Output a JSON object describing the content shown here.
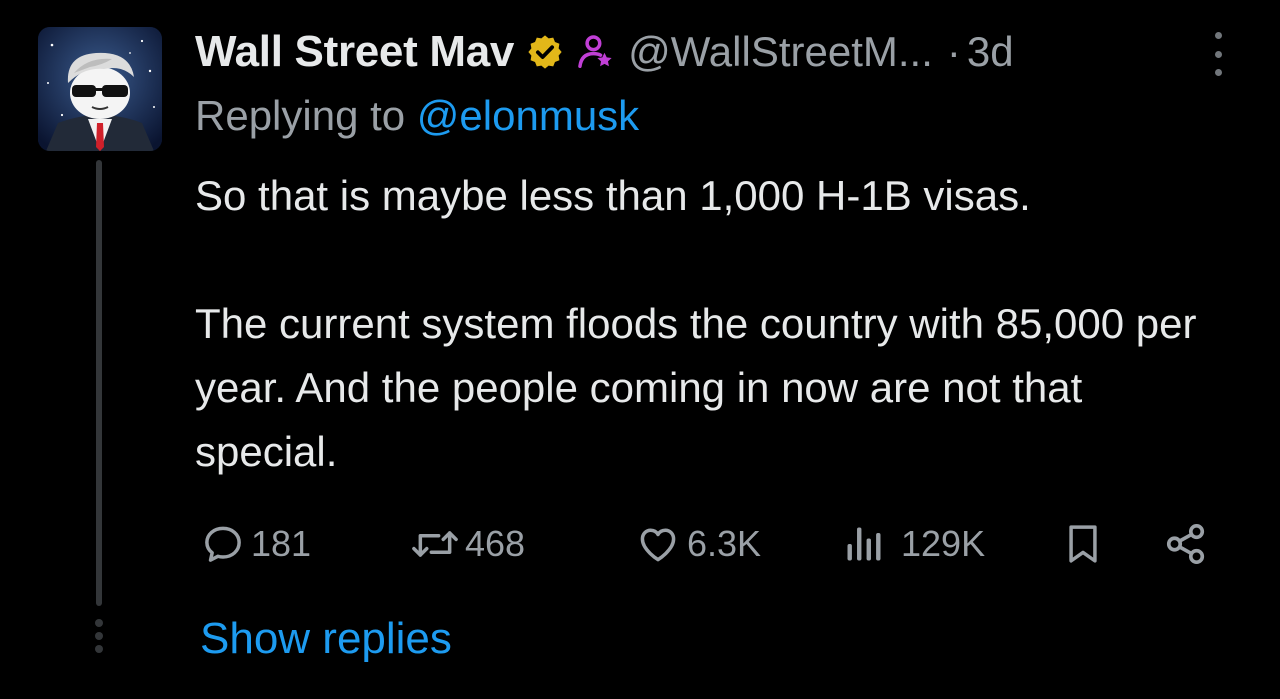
{
  "tweet": {
    "author": {
      "display_name": "Wall Street Mav",
      "handle": "@WallStreetM...",
      "verified_badge": "gold-verified-badge-icon",
      "affiliate_badge": "affiliate-person-icon"
    },
    "separator": "·",
    "time": "3d",
    "replying_prefix": "Replying to ",
    "replying_to": "@elonmusk",
    "text": "So that is maybe less than 1,000 H-1B visas.\n\nThe current system floods the country with 85,000 per year. And the people coming in now are not that special.",
    "actions": {
      "replies": "181",
      "reposts": "468",
      "likes": "6.3K",
      "views": "129K"
    },
    "show_replies_label": "Show replies"
  },
  "colors": {
    "background": "#000000",
    "primary_text": "#e7e9ea",
    "secondary_text": "#9aa0a6",
    "link": "#1d9bf0",
    "verified_gold": "#e2b719",
    "affiliate_purple": "#c13fd6"
  }
}
